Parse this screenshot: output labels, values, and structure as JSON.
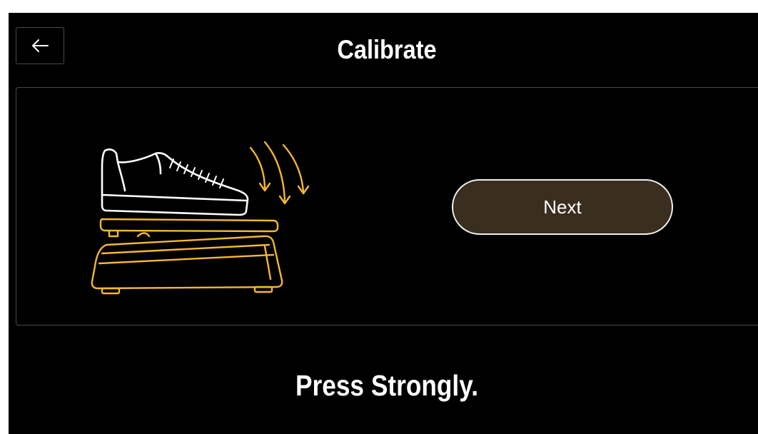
{
  "header": {
    "title": "Calibrate",
    "back_icon": "arrow-left-icon"
  },
  "panel": {
    "illustration": "shoe-pressing-pedal",
    "next_label": "Next"
  },
  "instruction": "Press Strongly.",
  "colors": {
    "background": "#000000",
    "pedal_accent": "#f5b731",
    "button_fill": "#3a2e1f",
    "border": "#4a4a4a"
  }
}
